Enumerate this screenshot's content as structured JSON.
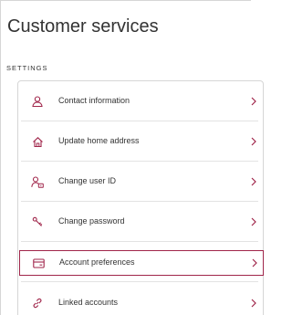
{
  "header": {
    "title": "Customer services"
  },
  "settings": {
    "section_label": "SETTINGS",
    "items": [
      {
        "label": "Contact information",
        "icon": "person-icon"
      },
      {
        "label": "Update home address",
        "icon": "home-icon"
      },
      {
        "label": "Change user ID",
        "icon": "user-id-icon"
      },
      {
        "label": "Change password",
        "icon": "key-icon"
      },
      {
        "label": "Account preferences",
        "icon": "card-icon",
        "selected": true
      },
      {
        "label": "Linked accounts",
        "icon": "link-icon"
      }
    ]
  },
  "colors": {
    "accent": "#a0254a",
    "text": "#333333",
    "border": "#d6d6d6"
  }
}
